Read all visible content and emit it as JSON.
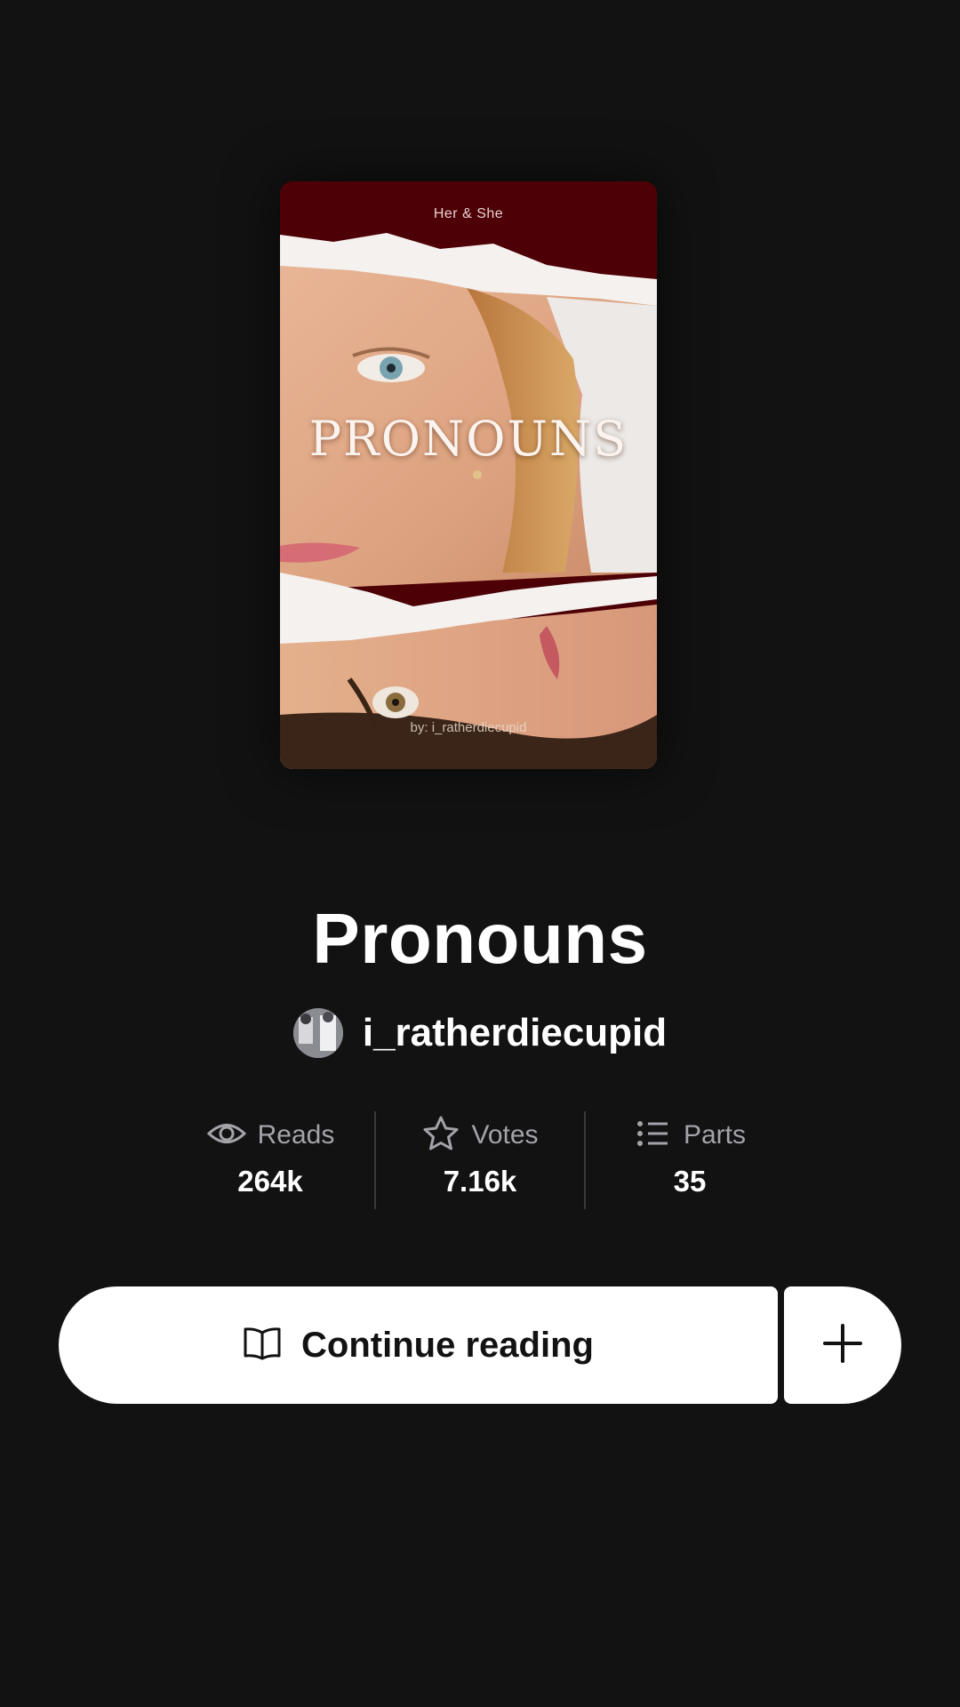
{
  "cover": {
    "subtitle": "Her & She",
    "title": "PRONOUNS",
    "byline": "by: i_ratherdiecupid",
    "colors": {
      "background": "#4d0005",
      "paper": "#f4f1ee"
    }
  },
  "story": {
    "title": "Pronouns",
    "author": "i_ratherdiecupid",
    "avatar_icon": "author-avatar"
  },
  "stats": [
    {
      "icon": "eye-icon",
      "label": "Reads",
      "value": "264k"
    },
    {
      "icon": "star-icon",
      "label": "Votes",
      "value": "7.16k"
    },
    {
      "icon": "list-icon",
      "label": "Parts",
      "value": "35"
    }
  ],
  "actions": {
    "continue_label": "Continue reading",
    "continue_icon": "book-icon",
    "add_icon": "plus-icon"
  }
}
